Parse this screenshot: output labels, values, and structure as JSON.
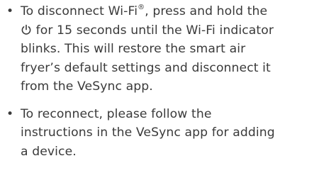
{
  "instructions": [
    {
      "line1_before_sup": "To disconnect Wi-Fi",
      "line1_sup": "®",
      "line1_after_sup": ", press and hold the",
      "line2_after_icon": " for 15 seconds until the Wi-Fi indicator",
      "line3": "blinks. This will restore the smart air",
      "line4": "fryer’s default settings and disconnect it",
      "line5": "from the VeSync app."
    },
    {
      "line1": "To reconnect, please follow the",
      "line2": "instructions in the VeSync app for adding",
      "line3": "a device."
    }
  ],
  "bullet_glyph": "•",
  "icons": {
    "power": "power-icon"
  },
  "colors": {
    "text": "#3a3a3a"
  }
}
